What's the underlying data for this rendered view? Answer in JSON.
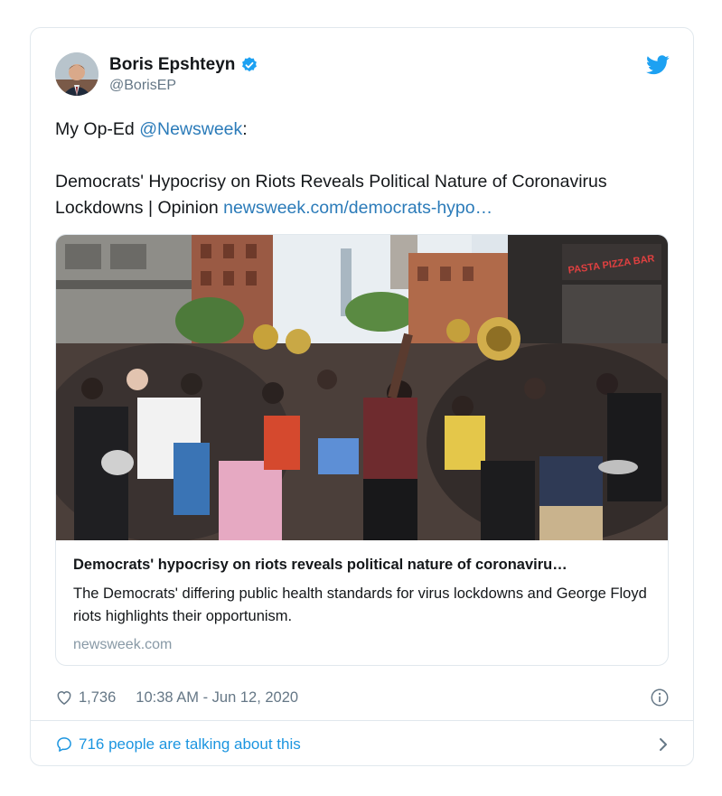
{
  "author": {
    "name": "Boris Epshteyn",
    "handle": "@BorisEP",
    "verified": true
  },
  "tweet": {
    "line1_prefix": "My Op-Ed ",
    "mention": "@Newsweek",
    "line1_suffix": ":",
    "line2": "Democrats' Hypocrisy on Riots Reveals Political Nature of Coronavirus",
    "line3_prefix": "Lockdowns | Opinion ",
    "link": "newsweek.com/democrats-hypo…"
  },
  "card": {
    "title": "Democrats' hypocrisy on riots reveals political nature of coronaviru…",
    "description": "The Democrats' differing public health standards for virus lockdowns and George Floyd riots highlights their opportunism.",
    "domain": "newsweek.com",
    "sign_text": "PASTA PIZZA BAR"
  },
  "meta": {
    "likes": "1,736",
    "timestamp": "10:38 AM - Jun 12, 2020"
  },
  "footer": {
    "talking": "716 people are talking about this"
  },
  "colors": {
    "link": "#2b7bb9",
    "twitter_blue": "#1da1f2",
    "secondary_text": "#657786",
    "border": "#e1e8ed"
  },
  "icons": [
    "twitter-bird-icon",
    "verified-badge-icon",
    "heart-icon",
    "info-icon",
    "comment-bubble-icon",
    "chevron-right-icon"
  ]
}
